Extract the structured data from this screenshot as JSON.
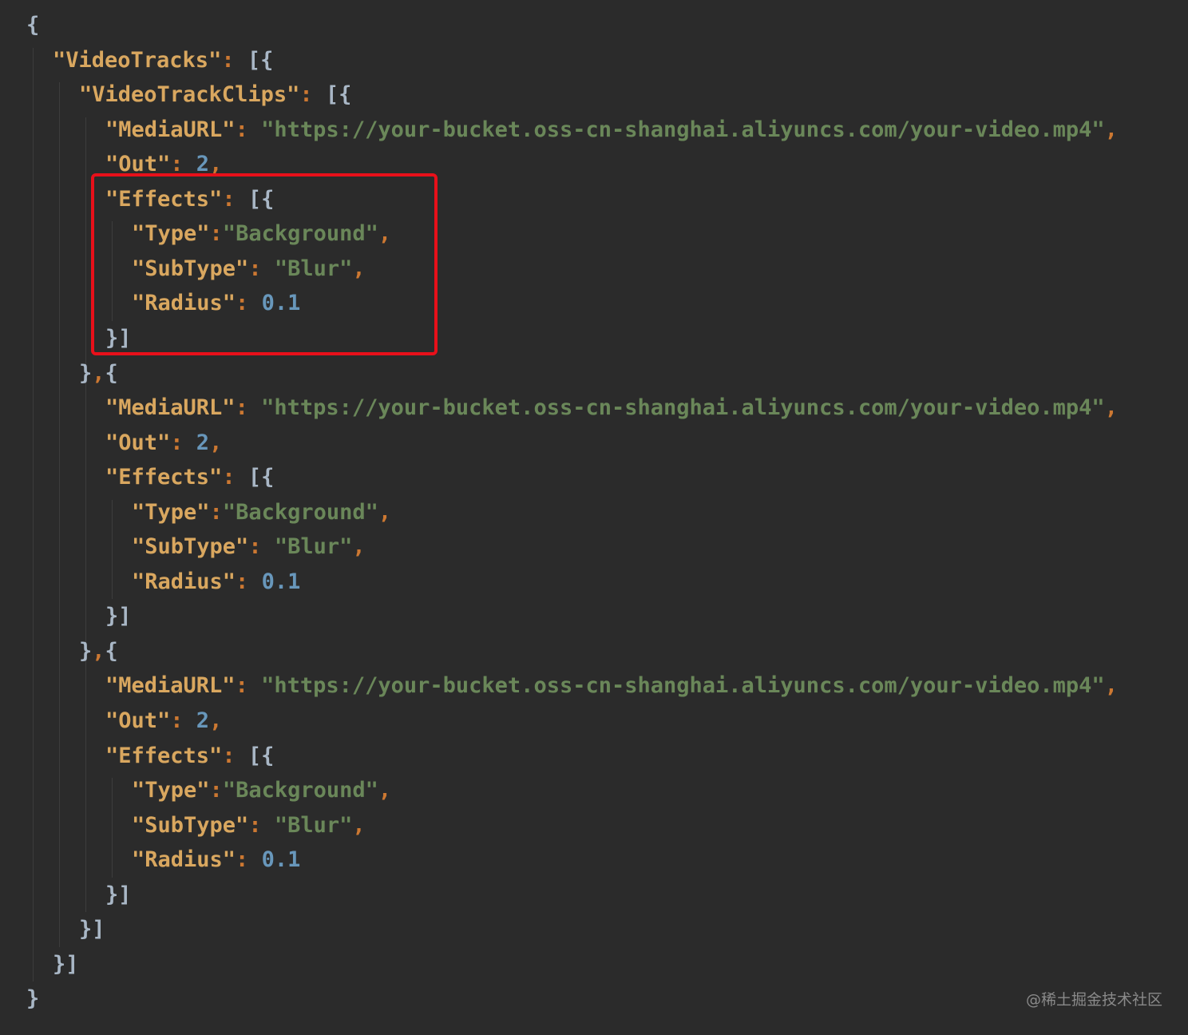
{
  "editor": {
    "theme_colors": {
      "background": "#2b2b2b",
      "key": "#d9a75f",
      "string": "#6a8759",
      "number": "#6897bb",
      "punctuation": "#cc7832",
      "brace": "#a9b7c6",
      "highlight_border": "#e8101a"
    },
    "lines": [
      {
        "indent": 0,
        "tokens": [
          {
            "t": "{",
            "c": "brace"
          }
        ]
      },
      {
        "indent": 1,
        "tokens": [
          {
            "t": "\"VideoTracks\"",
            "c": "key"
          },
          {
            "t": ": ",
            "c": "punc"
          },
          {
            "t": "[{",
            "c": "brace"
          }
        ]
      },
      {
        "indent": 2,
        "tokens": [
          {
            "t": "\"VideoTrackClips\"",
            "c": "key"
          },
          {
            "t": ": ",
            "c": "punc"
          },
          {
            "t": "[{",
            "c": "brace"
          }
        ]
      },
      {
        "indent": 3,
        "tokens": [
          {
            "t": "\"MediaURL\"",
            "c": "key"
          },
          {
            "t": ": ",
            "c": "punc"
          },
          {
            "t": "\"https://your-bucket.oss-cn-shanghai.aliyuncs.com/your-video.mp4\"",
            "c": "str"
          },
          {
            "t": ",",
            "c": "punc"
          }
        ]
      },
      {
        "indent": 3,
        "tokens": [
          {
            "t": "\"Out\"",
            "c": "key"
          },
          {
            "t": ": ",
            "c": "punc"
          },
          {
            "t": "2",
            "c": "num"
          },
          {
            "t": ",",
            "c": "punc"
          }
        ]
      },
      {
        "indent": 3,
        "tokens": [
          {
            "t": "\"Effects\"",
            "c": "key"
          },
          {
            "t": ": ",
            "c": "punc"
          },
          {
            "t": "[{",
            "c": "brace"
          }
        ]
      },
      {
        "indent": 4,
        "tokens": [
          {
            "t": "\"Type\"",
            "c": "key"
          },
          {
            "t": ":",
            "c": "punc"
          },
          {
            "t": "\"Background\"",
            "c": "str"
          },
          {
            "t": ",",
            "c": "punc"
          }
        ]
      },
      {
        "indent": 4,
        "tokens": [
          {
            "t": "\"SubType\"",
            "c": "key"
          },
          {
            "t": ": ",
            "c": "punc"
          },
          {
            "t": "\"Blur\"",
            "c": "str"
          },
          {
            "t": ",",
            "c": "punc"
          }
        ]
      },
      {
        "indent": 4,
        "tokens": [
          {
            "t": "\"Radius\"",
            "c": "key"
          },
          {
            "t": ": ",
            "c": "punc"
          },
          {
            "t": "0.1",
            "c": "num"
          }
        ]
      },
      {
        "indent": 3,
        "tokens": [
          {
            "t": "}]",
            "c": "brace"
          }
        ]
      },
      {
        "indent": 2,
        "tokens": [
          {
            "t": "}",
            "c": "brace"
          },
          {
            "t": ",",
            "c": "punc"
          },
          {
            "t": "{",
            "c": "brace"
          }
        ]
      },
      {
        "indent": 3,
        "tokens": [
          {
            "t": "\"MediaURL\"",
            "c": "key"
          },
          {
            "t": ": ",
            "c": "punc"
          },
          {
            "t": "\"https://your-bucket.oss-cn-shanghai.aliyuncs.com/your-video.mp4\"",
            "c": "str"
          },
          {
            "t": ",",
            "c": "punc"
          }
        ]
      },
      {
        "indent": 3,
        "tokens": [
          {
            "t": "\"Out\"",
            "c": "key"
          },
          {
            "t": ": ",
            "c": "punc"
          },
          {
            "t": "2",
            "c": "num"
          },
          {
            "t": ",",
            "c": "punc"
          }
        ]
      },
      {
        "indent": 3,
        "tokens": [
          {
            "t": "\"Effects\"",
            "c": "key"
          },
          {
            "t": ": ",
            "c": "punc"
          },
          {
            "t": "[{",
            "c": "brace"
          }
        ]
      },
      {
        "indent": 4,
        "tokens": [
          {
            "t": "\"Type\"",
            "c": "key"
          },
          {
            "t": ":",
            "c": "punc"
          },
          {
            "t": "\"Background\"",
            "c": "str"
          },
          {
            "t": ",",
            "c": "punc"
          }
        ]
      },
      {
        "indent": 4,
        "tokens": [
          {
            "t": "\"SubType\"",
            "c": "key"
          },
          {
            "t": ": ",
            "c": "punc"
          },
          {
            "t": "\"Blur\"",
            "c": "str"
          },
          {
            "t": ",",
            "c": "punc"
          }
        ]
      },
      {
        "indent": 4,
        "tokens": [
          {
            "t": "\"Radius\"",
            "c": "key"
          },
          {
            "t": ": ",
            "c": "punc"
          },
          {
            "t": "0.1",
            "c": "num"
          }
        ]
      },
      {
        "indent": 3,
        "tokens": [
          {
            "t": "}]",
            "c": "brace"
          }
        ]
      },
      {
        "indent": 2,
        "tokens": [
          {
            "t": "}",
            "c": "brace"
          },
          {
            "t": ",",
            "c": "punc"
          },
          {
            "t": "{",
            "c": "brace"
          }
        ]
      },
      {
        "indent": 3,
        "tokens": [
          {
            "t": "\"MediaURL\"",
            "c": "key"
          },
          {
            "t": ": ",
            "c": "punc"
          },
          {
            "t": "\"https://your-bucket.oss-cn-shanghai.aliyuncs.com/your-video.mp4\"",
            "c": "str"
          },
          {
            "t": ",",
            "c": "punc"
          }
        ]
      },
      {
        "indent": 3,
        "tokens": [
          {
            "t": "\"Out\"",
            "c": "key"
          },
          {
            "t": ": ",
            "c": "punc"
          },
          {
            "t": "2",
            "c": "num"
          },
          {
            "t": ",",
            "c": "punc"
          }
        ]
      },
      {
        "indent": 3,
        "tokens": [
          {
            "t": "\"Effects\"",
            "c": "key"
          },
          {
            "t": ": ",
            "c": "punc"
          },
          {
            "t": "[{",
            "c": "brace"
          }
        ]
      },
      {
        "indent": 4,
        "tokens": [
          {
            "t": "\"Type\"",
            "c": "key"
          },
          {
            "t": ":",
            "c": "punc"
          },
          {
            "t": "\"Background\"",
            "c": "str"
          },
          {
            "t": ",",
            "c": "punc"
          }
        ]
      },
      {
        "indent": 4,
        "tokens": [
          {
            "t": "\"SubType\"",
            "c": "key"
          },
          {
            "t": ": ",
            "c": "punc"
          },
          {
            "t": "\"Blur\"",
            "c": "str"
          },
          {
            "t": ",",
            "c": "punc"
          }
        ]
      },
      {
        "indent": 4,
        "tokens": [
          {
            "t": "\"Radius\"",
            "c": "key"
          },
          {
            "t": ": ",
            "c": "punc"
          },
          {
            "t": "0.1",
            "c": "num"
          }
        ]
      },
      {
        "indent": 3,
        "tokens": [
          {
            "t": "}]",
            "c": "brace"
          }
        ]
      },
      {
        "indent": 2,
        "tokens": [
          {
            "t": "}]",
            "c": "brace"
          }
        ]
      },
      {
        "indent": 1,
        "tokens": [
          {
            "t": "}]",
            "c": "brace"
          }
        ]
      },
      {
        "indent": 0,
        "tokens": [
          {
            "t": "}",
            "c": "brace"
          }
        ]
      }
    ]
  },
  "watermark": {
    "text": "@稀土掘金技术社区"
  }
}
